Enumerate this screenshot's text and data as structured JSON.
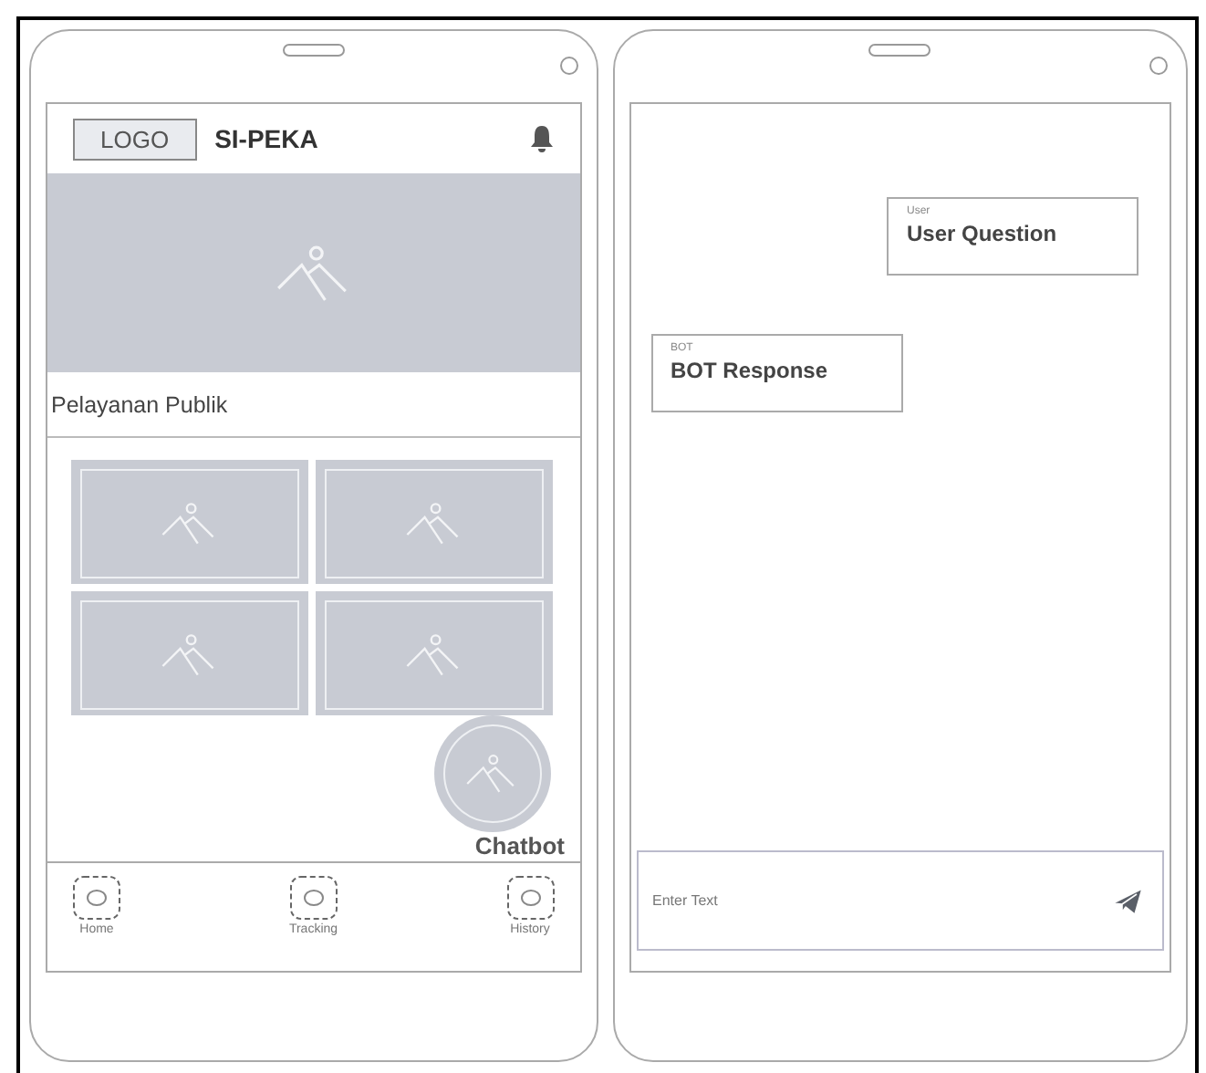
{
  "home_screen": {
    "logo": "LOGO",
    "app_title": "SI-PEKA",
    "section_title": "Pelayanan Publik",
    "chatbot_button": {
      "label": "Chatbot"
    },
    "nav_items": [
      {
        "label": "Home"
      },
      {
        "label": "Tracking"
      },
      {
        "label": "History"
      }
    ]
  },
  "chat_screen": {
    "messages": [
      {
        "kind": "user",
        "sender": "User",
        "text": "User Question"
      },
      {
        "kind": "bot",
        "sender": "BOT",
        "text": "BOT Response"
      }
    ],
    "input": {
      "placeholder": "Enter Text"
    }
  }
}
